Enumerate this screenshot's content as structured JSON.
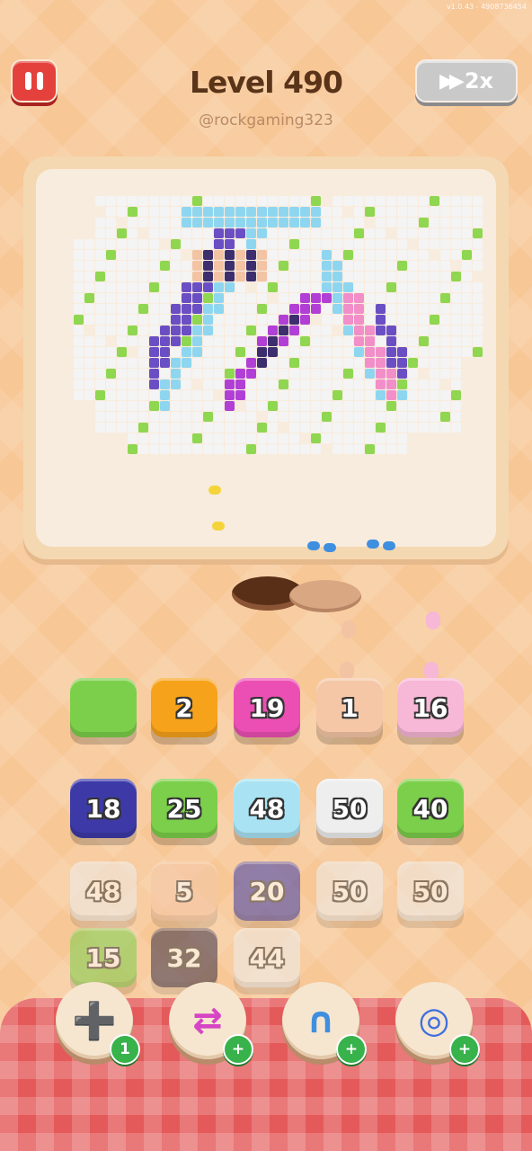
{
  "header": {
    "version": "v1.0.43 - 4908736454",
    "level_title": "Level 490",
    "handle": "@rockgaming323",
    "speed_label": "2x"
  },
  "icons": {
    "pause": "pause-icon",
    "speed": "fast-forward-icon"
  },
  "tiles": [
    {
      "label": "",
      "color": "#7ccf4a",
      "row": 0,
      "col": 0,
      "state": "active"
    },
    {
      "label": "2",
      "color": "#f7a21b",
      "row": 0,
      "col": 1,
      "state": "active"
    },
    {
      "label": "19",
      "color": "#ec4fb3",
      "row": 0,
      "col": 2,
      "state": "active"
    },
    {
      "label": "1",
      "color": "#f5c7a7",
      "row": 0,
      "col": 3,
      "state": "active"
    },
    {
      "label": "16",
      "color": "#f7b7d6",
      "row": 0,
      "col": 4,
      "state": "active"
    },
    {
      "label": "18",
      "color": "#3d3aa8",
      "row": 1,
      "col": 0,
      "state": "active"
    },
    {
      "label": "25",
      "color": "#7ccf4a",
      "row": 1,
      "col": 1,
      "state": "active"
    },
    {
      "label": "48",
      "color": "#a9e3f3",
      "row": 1,
      "col": 2,
      "state": "active"
    },
    {
      "label": "50",
      "color": "#eeeeee",
      "row": 1,
      "col": 3,
      "state": "active"
    },
    {
      "label": "40",
      "color": "#7ccf4a",
      "row": 1,
      "col": 4,
      "state": "active"
    },
    {
      "label": "48",
      "color": "#eeeeee",
      "row": 2,
      "col": 0,
      "state": "faded"
    },
    {
      "label": "5",
      "color": "#f5c7a7",
      "row": 2,
      "col": 1,
      "state": "faded"
    },
    {
      "label": "20",
      "color": "#3d3aa8",
      "row": 2,
      "col": 2,
      "state": "faded"
    },
    {
      "label": "50",
      "color": "#eeeeee",
      "row": 2,
      "col": 3,
      "state": "faded"
    },
    {
      "label": "50",
      "color": "#eeeeee",
      "row": 2,
      "col": 4,
      "state": "faded"
    },
    {
      "label": "15",
      "color": "#7ccf4a",
      "row": 3,
      "col": 0,
      "state": "faded"
    },
    {
      "label": "32",
      "color": "#3a2f44",
      "row": 3,
      "col": 1,
      "state": "faded"
    },
    {
      "label": "44",
      "color": "#eeeeee",
      "row": 3,
      "col": 2,
      "state": "faded"
    }
  ],
  "boosters": [
    {
      "name": "add-slot-booster",
      "icon": "add-tray-icon",
      "badge": "1"
    },
    {
      "name": "swap-booster",
      "icon": "swap-arrows-icon",
      "badge": "+"
    },
    {
      "name": "magnet-booster",
      "icon": "magnet-icon",
      "badge": "+"
    },
    {
      "name": "shuffle-booster",
      "icon": "spool-icon",
      "badge": "+"
    }
  ],
  "palette": {
    "white": "#f4f4f4",
    "green": "#8fd651",
    "dark_purple": "#3d2e6e",
    "purple": "#6a4fc4",
    "blue": "#3f8fe0",
    "light_blue": "#8ed6f0",
    "magenta": "#b13fd6",
    "pink": "#f28ec8",
    "peach": "#f3c4a4",
    "yellow": "#f5d43a"
  }
}
